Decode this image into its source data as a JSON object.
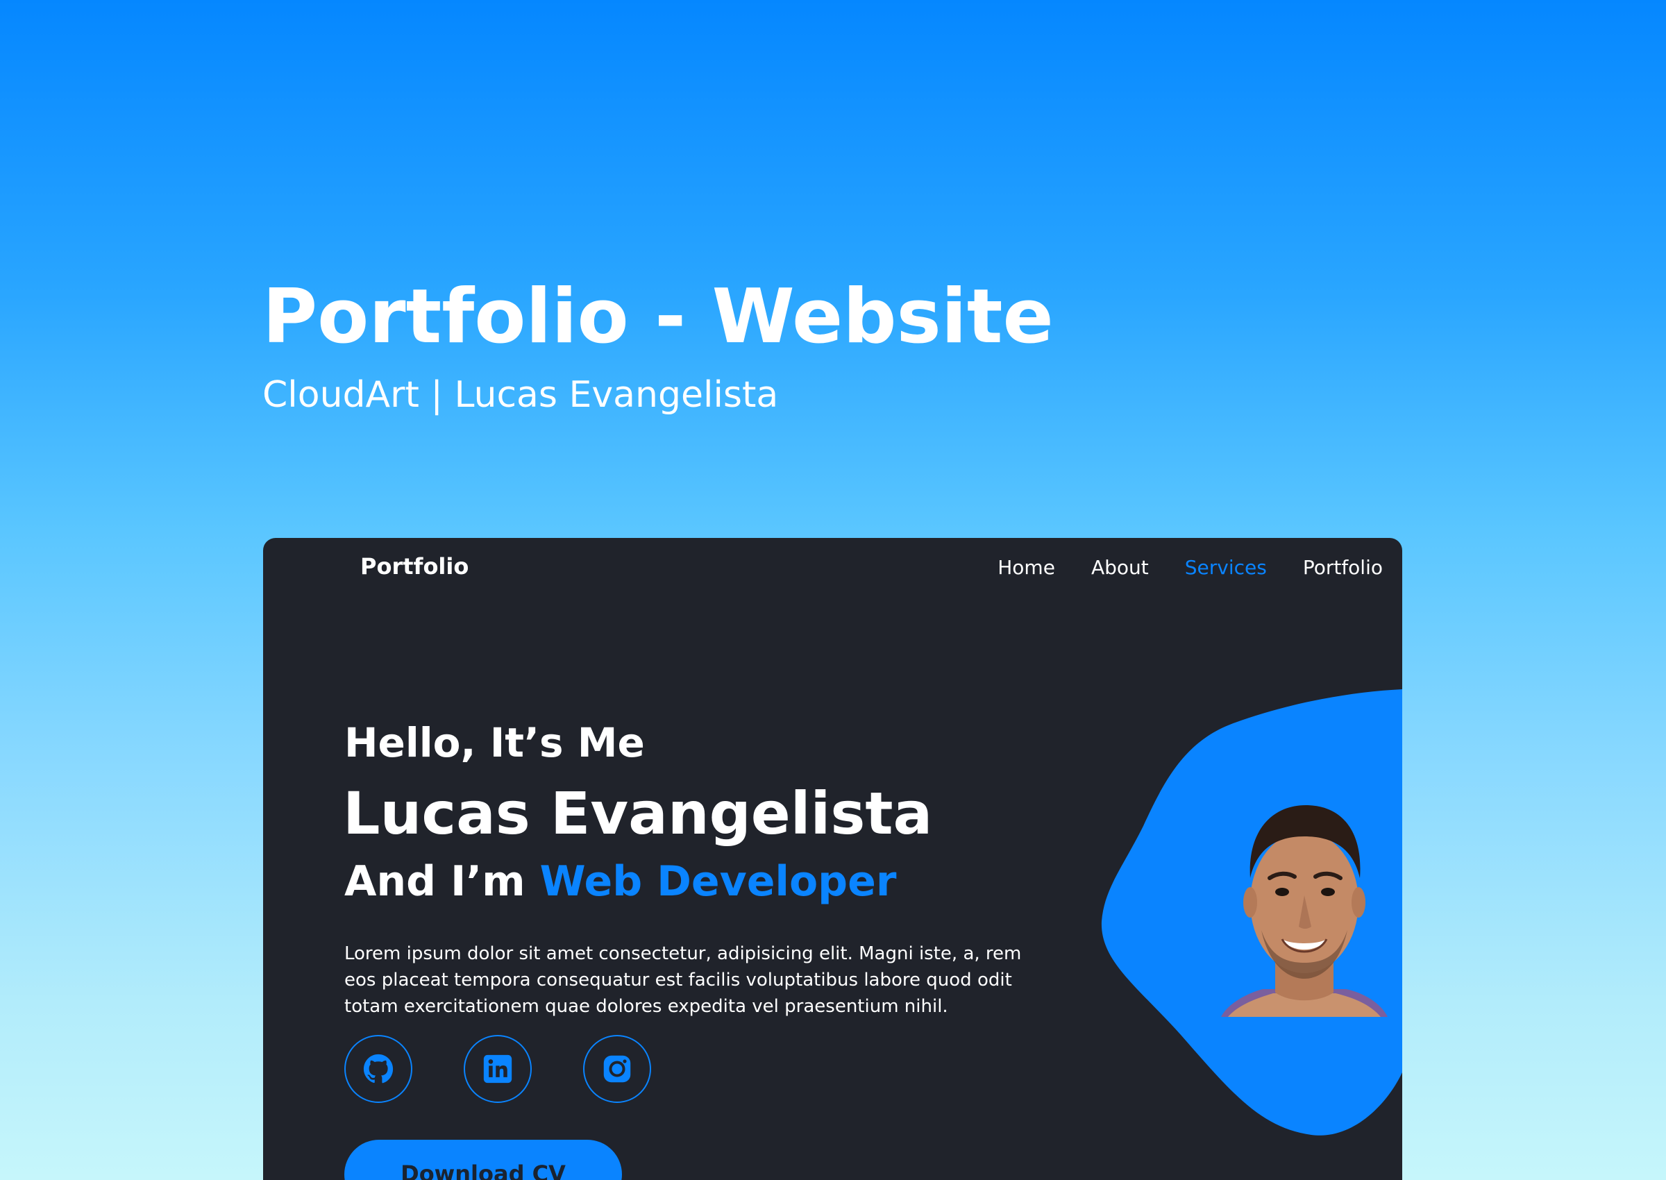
{
  "showcase": {
    "title": "Portfolio - Website",
    "subtitle": "CloudArt | Lucas Evangelista"
  },
  "site": {
    "brand": "Portfolio",
    "nav": [
      {
        "label": "Home",
        "active": false
      },
      {
        "label": "About",
        "active": false
      },
      {
        "label": "Services",
        "active": true
      },
      {
        "label": "Portfolio",
        "active": false
      }
    ],
    "hero": {
      "intro": "Hello, It’s Me",
      "name": "Lucas Evangelista",
      "role_prefix": "And I’m ",
      "role": "Web Developer",
      "bio": "Lorem ipsum dolor sit amet consectetur, adipisicing elit. Magni iste, a, rem eos placeat tempora consequatur est facilis voluptatibus labore quod odit totam exercitationem quae dolores expedita vel praesentium nihil.",
      "socials": [
        {
          "icon": "github-icon"
        },
        {
          "icon": "linkedin-icon"
        },
        {
          "icon": "instagram-icon"
        }
      ],
      "cta_label": "Download CV"
    }
  },
  "colors": {
    "accent": "#0a84ff",
    "panel_bg": "#20232b",
    "page_gradient_top": "#0587ff",
    "page_gradient_bottom": "#c6f6fb"
  }
}
